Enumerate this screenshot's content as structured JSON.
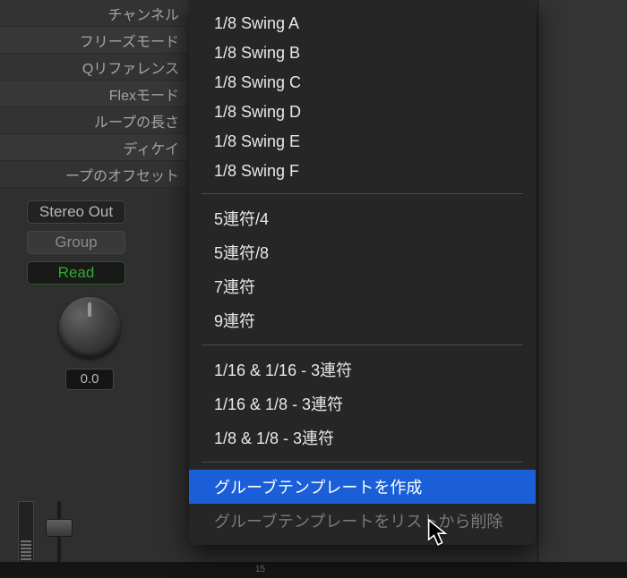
{
  "inspector": {
    "params": [
      "チャンネル",
      "フリーズモード",
      "Qリファレンス",
      "Flexモード",
      "ループの長さ",
      "ディケイ",
      "ープのオフセット"
    ]
  },
  "channel": {
    "output": "Stereo Out",
    "group": "Group",
    "automation": "Read",
    "pan_value": "0.0"
  },
  "ruler": {
    "tick": "15"
  },
  "menu": {
    "swing": [
      "1/8 Swing A",
      "1/8 Swing B",
      "1/8 Swing C",
      "1/8 Swing D",
      "1/8 Swing E",
      "1/8 Swing F"
    ],
    "tuplets": [
      "5連符/4",
      "5連符/8",
      "7連符",
      "9連符"
    ],
    "compound": [
      "1/16 & 1/16 - 3連符",
      "1/16 & 1/8 - 3連符",
      "1/8 & 1/8 - 3連符"
    ],
    "create_template": "グルーブテンプレートを作成",
    "remove_template": "グルーブテンプレートをリストから削除"
  }
}
